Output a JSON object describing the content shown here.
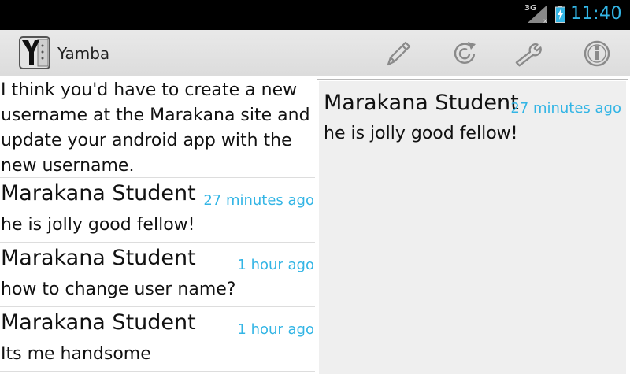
{
  "status_bar": {
    "time": "11:40",
    "network": "3G",
    "signal_icon": "signal-icon",
    "battery_icon": "battery-charging-icon",
    "accent_color": "#33b5e5"
  },
  "action_bar": {
    "app_icon": "yamba-logo-icon",
    "title": "Yamba",
    "actions": [
      {
        "name": "compose",
        "icon": "pencil-icon"
      },
      {
        "name": "refresh",
        "icon": "refresh-icon"
      },
      {
        "name": "preferences",
        "icon": "wrench-icon"
      },
      {
        "name": "info",
        "icon": "info-icon"
      }
    ]
  },
  "timeline": {
    "first_row_text": "I think you'd have to create a new username at the Marakana site and update your android app with the new username.",
    "items": [
      {
        "user": "Marakana Student",
        "time": "27 minutes ago",
        "text": "he is jolly good fellow!"
      },
      {
        "user": "Marakana Student",
        "time": "1 hour ago",
        "text": "how to change user name?"
      },
      {
        "user": "Marakana Student",
        "time": "1 hour ago",
        "text": "Its me handsome"
      }
    ]
  },
  "detail": {
    "user": "Marakana Student",
    "time": "27 minutes ago",
    "text": "he is jolly good fellow!"
  }
}
